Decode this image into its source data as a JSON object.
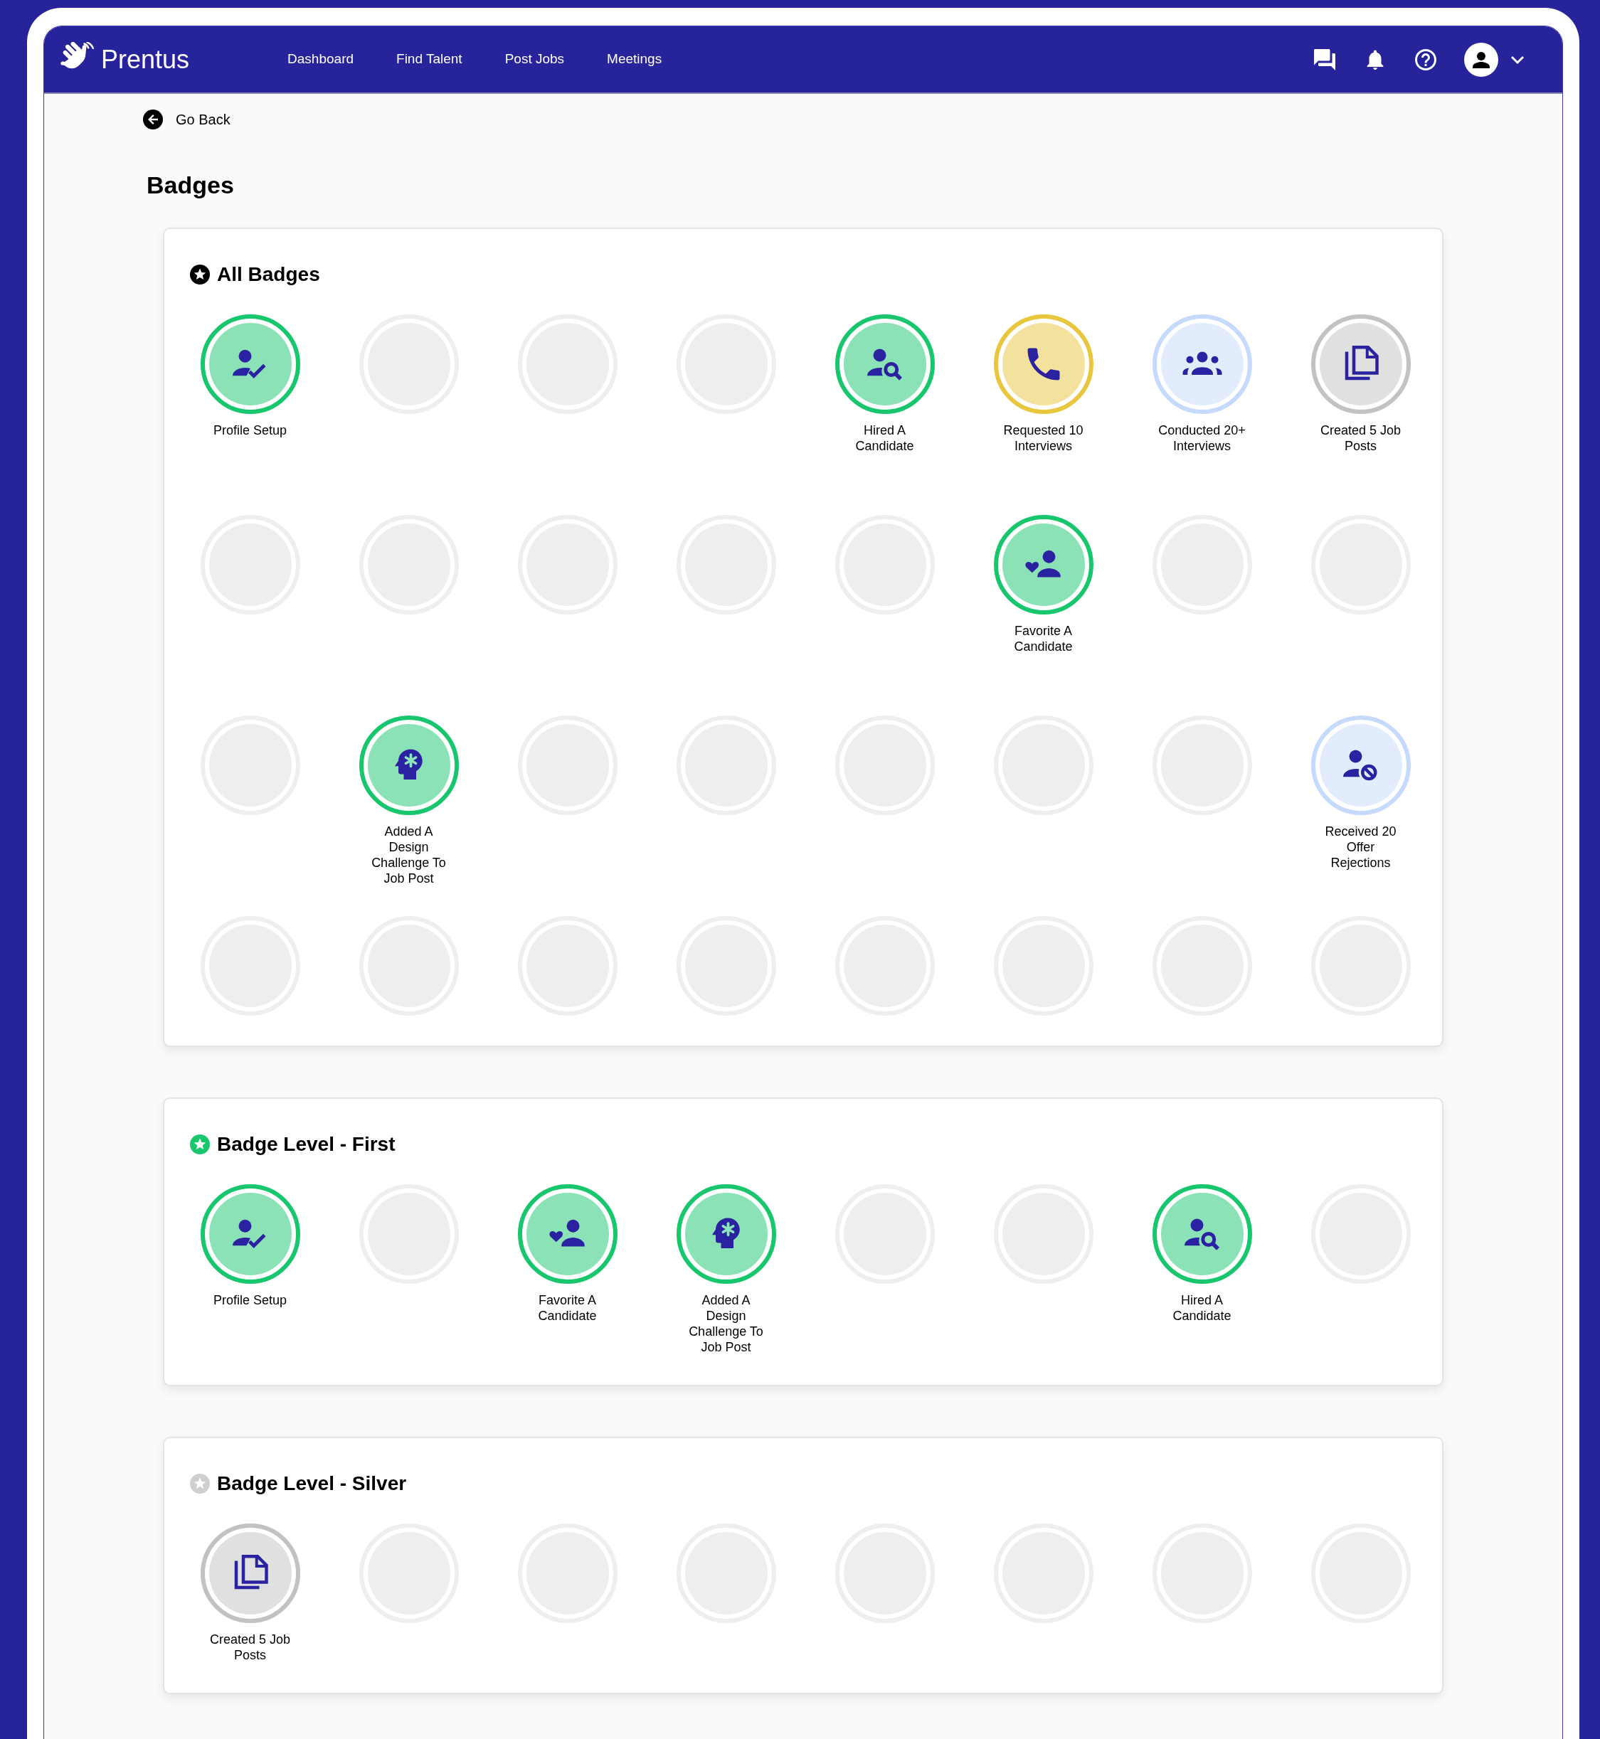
{
  "nav": {
    "brand": "Prentus",
    "links": [
      "Dashboard",
      "Find Talent",
      "Post Jobs",
      "Meetings"
    ]
  },
  "back": "Go Back",
  "title": "Badges",
  "sections": [
    {
      "title": "All Badges",
      "kind": "all",
      "badges": [
        {
          "kind": "verified",
          "color": "#18c66e",
          "label": "Profile Setup"
        },
        {
          "kind": "empty"
        },
        {
          "kind": "empty"
        },
        {
          "kind": "empty"
        },
        {
          "kind": "search",
          "color": "#18c66e",
          "label": "Hired A Candidate"
        },
        {
          "kind": "phone",
          "color": "#e8c63e",
          "label": "Requested 10 Interviews"
        },
        {
          "kind": "group",
          "color": "#c5dafc",
          "label": "Conducted 20+ Interviews"
        },
        {
          "kind": "document",
          "color": "#c2c2c2",
          "label": "Created 5 Job Posts"
        },
        {
          "kind": "empty"
        },
        {
          "kind": "empty"
        },
        {
          "kind": "empty"
        },
        {
          "kind": "empty"
        },
        {
          "kind": "empty"
        },
        {
          "kind": "favorite",
          "color": "#18c66e",
          "label": "Favorite A Candidate"
        },
        {
          "kind": "empty"
        },
        {
          "kind": "empty"
        },
        {
          "kind": "empty"
        },
        {
          "kind": "idea",
          "color": "#18c66e",
          "label": "Added A Design Challenge To Job Post"
        },
        {
          "kind": "empty"
        },
        {
          "kind": "empty"
        },
        {
          "kind": "empty"
        },
        {
          "kind": "empty"
        },
        {
          "kind": "empty"
        },
        {
          "kind": "blocked",
          "color": "#c5dafc",
          "label": "Received 20 Offer Rejections"
        },
        {
          "kind": "empty"
        },
        {
          "kind": "empty"
        },
        {
          "kind": "empty"
        },
        {
          "kind": "empty"
        },
        {
          "kind": "empty"
        },
        {
          "kind": "empty"
        },
        {
          "kind": "empty"
        },
        {
          "kind": "empty"
        }
      ]
    },
    {
      "title": "Badge Level - First",
      "kind": "first",
      "badges": [
        {
          "kind": "verified",
          "color": "#18c66e",
          "label": "Profile Setup"
        },
        {
          "kind": "empty"
        },
        {
          "kind": "favorite",
          "color": "#18c66e",
          "label": "Favorite A Candidate"
        },
        {
          "kind": "idea",
          "color": "#18c66e",
          "label": "Added A Design Challenge To Job Post"
        },
        {
          "kind": "empty"
        },
        {
          "kind": "empty"
        },
        {
          "kind": "search",
          "color": "#18c66e",
          "label": "Hired A Candidate"
        },
        {
          "kind": "empty"
        }
      ]
    },
    {
      "title": "Badge Level - Silver",
      "kind": "silver",
      "badges": [
        {
          "kind": "document",
          "color": "#c2c2c2",
          "label": "Created 5 Job Posts"
        },
        {
          "kind": "empty"
        },
        {
          "kind": "empty"
        },
        {
          "kind": "empty"
        },
        {
          "kind": "empty"
        },
        {
          "kind": "empty"
        },
        {
          "kind": "empty"
        },
        {
          "kind": "empty"
        }
      ]
    }
  ]
}
